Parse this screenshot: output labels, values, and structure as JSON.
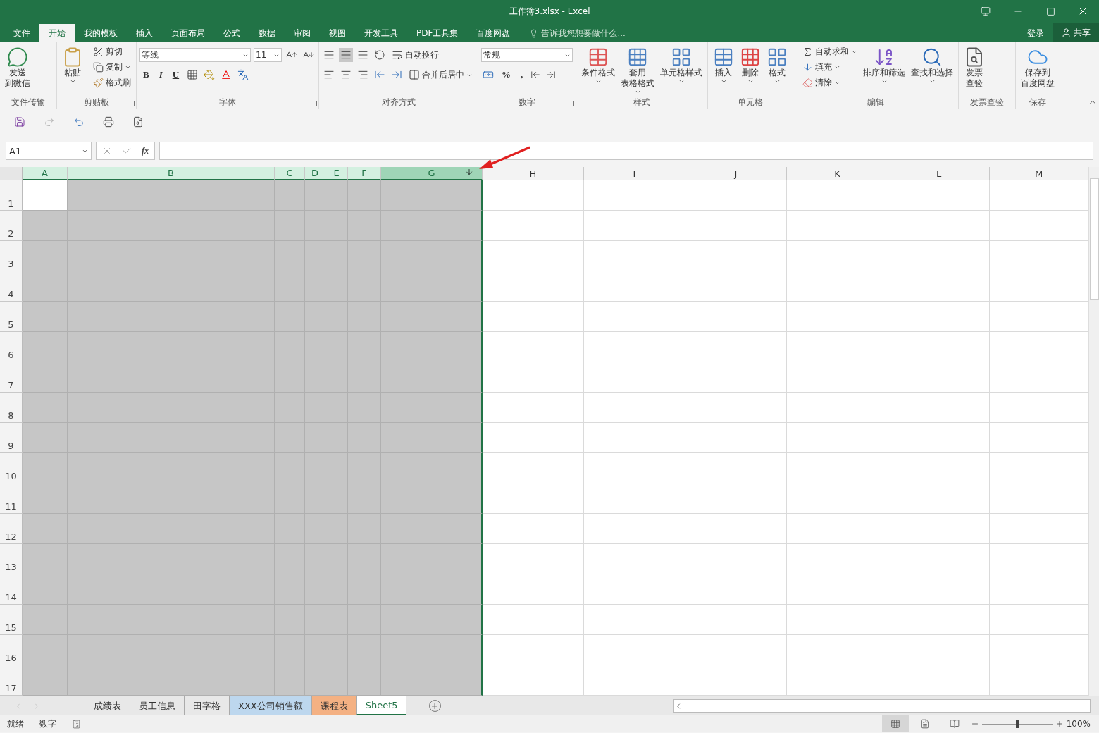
{
  "window": {
    "title": "工作簿3.xlsx - Excel"
  },
  "ribbon_tabs": [
    {
      "label": "文件",
      "selected": false
    },
    {
      "label": "开始",
      "selected": true
    },
    {
      "label": "我的模板",
      "selected": false
    },
    {
      "label": "插入",
      "selected": false
    },
    {
      "label": "页面布局",
      "selected": false
    },
    {
      "label": "公式",
      "selected": false
    },
    {
      "label": "数据",
      "selected": false
    },
    {
      "label": "审阅",
      "selected": false
    },
    {
      "label": "视图",
      "selected": false
    },
    {
      "label": "开发工具",
      "selected": false
    },
    {
      "label": "PDF工具集",
      "selected": false
    },
    {
      "label": "百度网盘",
      "selected": false
    }
  ],
  "tell_me": {
    "placeholder": "告诉我您想要做什么..."
  },
  "account": {
    "login": "登录",
    "share": "共享"
  },
  "ribbon_groups": [
    {
      "kind": "buttons",
      "label": "文件传输",
      "launcher": false,
      "items": [
        {
          "kind": "large",
          "lines": [
            "发送",
            "到微信"
          ],
          "dropdown": false
        }
      ]
    },
    {
      "kind": "buttons",
      "label": "剪贴板",
      "launcher": true,
      "items": [
        {
          "kind": "large",
          "lines": [
            "粘贴"
          ],
          "dropdown": true
        },
        {
          "kind": "small",
          "label": "剪切",
          "dropdown": false
        },
        {
          "kind": "small",
          "label": "复制",
          "dropdown": true
        },
        {
          "kind": "small",
          "label": "格式刷",
          "dropdown": false
        }
      ]
    },
    {
      "kind": "font",
      "label": "字体",
      "launcher": true,
      "font_name": "等线",
      "font_size": "11",
      "styles": [
        "B",
        "I",
        "U"
      ]
    },
    {
      "kind": "alignment",
      "label": "对齐方式",
      "launcher": true,
      "wrap": "自动换行",
      "merge": "合并后居中"
    },
    {
      "kind": "number",
      "label": "数字",
      "launcher": true,
      "format": "常规",
      "symbols": [
        "%",
        ","
      ]
    },
    {
      "kind": "buttons",
      "label": "样式",
      "launcher": false,
      "items": [
        {
          "kind": "large",
          "lines": [
            "条件格式"
          ],
          "dropdown": true
        },
        {
          "kind": "large",
          "lines": [
            "套用",
            "表格格式"
          ],
          "dropdown": true
        },
        {
          "kind": "large",
          "lines": [
            "单元格样式"
          ],
          "dropdown": true
        }
      ]
    },
    {
      "kind": "buttons",
      "label": "单元格",
      "launcher": false,
      "items": [
        {
          "kind": "large",
          "lines": [
            "插入"
          ],
          "dropdown": true
        },
        {
          "kind": "large",
          "lines": [
            "删除"
          ],
          "dropdown": true
        },
        {
          "kind": "large",
          "lines": [
            "格式"
          ],
          "dropdown": true
        }
      ]
    },
    {
      "kind": "buttons",
      "label": "编辑",
      "launcher": false,
      "items": [
        {
          "kind": "small",
          "label": "自动求和",
          "dropdown": true
        },
        {
          "kind": "small",
          "label": "填充",
          "dropdown": true
        },
        {
          "kind": "small",
          "label": "清除",
          "dropdown": true
        },
        {
          "kind": "large",
          "lines": [
            "排序和筛选"
          ],
          "dropdown": true
        },
        {
          "kind": "large",
          "lines": [
            "查找和选择"
          ],
          "dropdown": true
        }
      ]
    },
    {
      "kind": "buttons",
      "label": "发票查验",
      "launcher": false,
      "items": [
        {
          "kind": "large",
          "lines": [
            "发票",
            "查验"
          ],
          "dropdown": false
        }
      ]
    },
    {
      "kind": "buttons",
      "label": "保存",
      "launcher": false,
      "items": [
        {
          "kind": "large",
          "lines": [
            "保存到",
            "百度网盘"
          ],
          "dropdown": false
        }
      ]
    }
  ],
  "formula_bar": {
    "name_box": "A1",
    "fx": "fx"
  },
  "columns": [
    {
      "label": "A",
      "selected": true,
      "hovered": false
    },
    {
      "label": "B",
      "selected": true,
      "hovered": false
    },
    {
      "label": "C",
      "selected": true,
      "hovered": false
    },
    {
      "label": "D",
      "selected": true,
      "hovered": false
    },
    {
      "label": "E",
      "selected": true,
      "hovered": false
    },
    {
      "label": "F",
      "selected": true,
      "hovered": false
    },
    {
      "label": "G",
      "selected": true,
      "hovered": true
    },
    {
      "label": "H",
      "selected": false,
      "hovered": false
    },
    {
      "label": "I",
      "selected": false,
      "hovered": false
    },
    {
      "label": "J",
      "selected": false,
      "hovered": false
    },
    {
      "label": "K",
      "selected": false,
      "hovered": false
    },
    {
      "label": "L",
      "selected": false,
      "hovered": false
    },
    {
      "label": "M",
      "selected": false,
      "hovered": false
    }
  ],
  "rows": [
    {
      "label": "1",
      "active": true
    },
    {
      "label": "2",
      "active": false
    },
    {
      "label": "3",
      "active": false
    },
    {
      "label": "4",
      "active": false
    },
    {
      "label": "5",
      "active": false
    },
    {
      "label": "6",
      "active": false
    },
    {
      "label": "7",
      "active": false
    },
    {
      "label": "8",
      "active": false
    },
    {
      "label": "9",
      "active": false
    },
    {
      "label": "10",
      "active": false
    },
    {
      "label": "11",
      "active": false
    },
    {
      "label": "12",
      "active": false
    },
    {
      "label": "13",
      "active": false
    },
    {
      "label": "14",
      "active": false
    },
    {
      "label": "15",
      "active": false
    },
    {
      "label": "16",
      "active": false
    },
    {
      "label": "17",
      "active": false
    }
  ],
  "sheet_tabs": [
    {
      "label": "成绩表",
      "selected": false
    },
    {
      "label": "员工信息",
      "selected": false
    },
    {
      "label": "田字格",
      "selected": false
    },
    {
      "label": "XXX公司销售额",
      "selected": false,
      "color": "#bdd7ee"
    },
    {
      "label": "课程表",
      "selected": false,
      "color": "#f4b183"
    },
    {
      "label": "Sheet5",
      "selected": true
    }
  ],
  "status_bar": {
    "items": [
      "就绪",
      "数字"
    ],
    "view_buttons": [
      {
        "selected": true
      },
      {
        "selected": false
      },
      {
        "selected": false
      }
    ],
    "zoom": {
      "level": 0.5,
      "reading": "100%"
    }
  }
}
